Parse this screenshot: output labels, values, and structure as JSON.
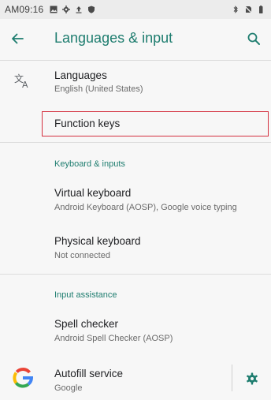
{
  "status_bar": {
    "time": "AM09:16",
    "left_icons": [
      "gallery-icon",
      "settings-gear-icon",
      "upload-icon",
      "shield-icon"
    ],
    "right_icons": [
      "bluetooth-icon",
      "no-sim-icon",
      "battery-icon"
    ]
  },
  "app_bar": {
    "title": "Languages & input",
    "back_icon": "arrow-back-icon",
    "search_icon": "search-icon"
  },
  "items": {
    "languages": {
      "title": "Languages",
      "subtitle": "English (United States)",
      "icon": "translate-icon"
    },
    "function_keys": {
      "title": "Function keys"
    },
    "section_keyboard": "Keyboard & inputs",
    "virtual_keyboard": {
      "title": "Virtual keyboard",
      "subtitle": "Android Keyboard (AOSP), Google voice typing"
    },
    "physical_keyboard": {
      "title": "Physical keyboard",
      "subtitle": "Not connected"
    },
    "section_assistance": "Input assistance",
    "spell_checker": {
      "title": "Spell checker",
      "subtitle": "Android Spell Checker (AOSP)"
    },
    "autofill": {
      "title": "Autofill service",
      "subtitle": "Google",
      "icon": "google-g-icon",
      "action_icon": "gear-icon"
    }
  },
  "colors": {
    "accent": "#1e7d6f",
    "highlight_border": "#d4303f",
    "background": "#f7f7f7"
  }
}
